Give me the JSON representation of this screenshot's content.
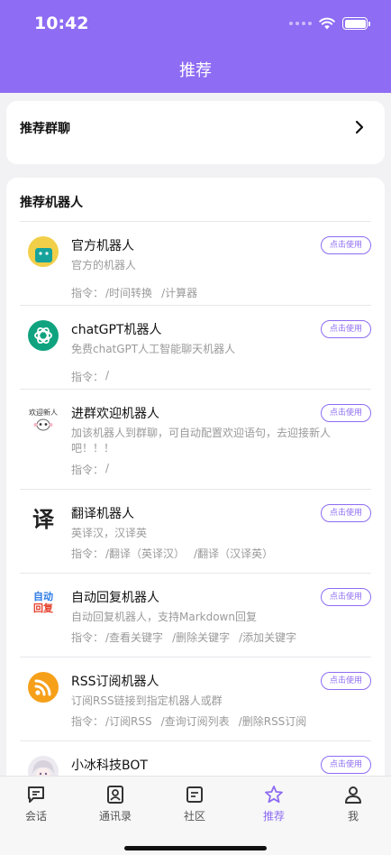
{
  "status": {
    "time": "10:42"
  },
  "nav": {
    "title": "推荐"
  },
  "group_section": {
    "title": "推荐群聊"
  },
  "bots_section": {
    "title": "推荐机器人",
    "use_label": "点击使用",
    "cmd_label": "指令：",
    "items": [
      {
        "name": "官方机器人",
        "desc": "官方的机器人",
        "cmds": [
          "/时间转换",
          "/计算器"
        ],
        "icon": "official-bot-icon"
      },
      {
        "name": "chatGPT机器人",
        "desc": "免费chatGPT人工智能聊天机器人",
        "cmds": [
          "/"
        ],
        "icon": "chatgpt-icon"
      },
      {
        "name": "进群欢迎机器人",
        "desc": "加该机器人到群聊，可自动配置欢迎语句，去迎接新人吧！！！",
        "cmds": [
          "/"
        ],
        "icon": "welcome-bot-icon",
        "avatar_text": "欢迎新人"
      },
      {
        "name": "翻译机器人",
        "desc": "英译汉，汉译英",
        "cmds": [
          "/翻译（英译汉）",
          "/翻译（汉译英）"
        ],
        "icon": "translate-icon",
        "avatar_text": "译"
      },
      {
        "name": "自动回复机器人",
        "desc": "自动回复机器人，支持Markdown回复",
        "cmds": [
          "/查看关键字",
          "/删除关键字",
          "/添加关键字"
        ],
        "icon": "auto-reply-icon",
        "avatar_text": [
          "自动",
          "回复"
        ]
      },
      {
        "name": "RSS订阅机器人",
        "desc": "订阅RSS链接到指定机器人或群",
        "cmds": [
          "/订阅RSS",
          "/查询订阅列表",
          "/删除RSS订阅"
        ],
        "icon": "rss-icon"
      },
      {
        "name": "小冰科技BOT",
        "desc": "",
        "cmds": [],
        "icon": "xiaobing-avatar"
      }
    ]
  },
  "tabbar": {
    "items": [
      {
        "label": "会话",
        "icon": "chat-icon"
      },
      {
        "label": "通讯录",
        "icon": "contacts-icon"
      },
      {
        "label": "社区",
        "icon": "community-icon"
      },
      {
        "label": "推荐",
        "icon": "star-icon",
        "active": true
      },
      {
        "label": "我",
        "icon": "person-icon"
      }
    ]
  },
  "colors": {
    "accent": "#8e6cf3",
    "background": "#f2f2f4"
  }
}
